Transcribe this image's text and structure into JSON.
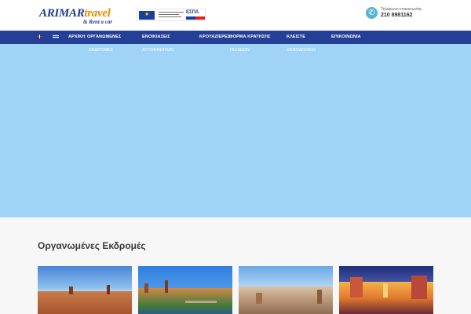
{
  "header": {
    "logo": {
      "main_a": "ARIMAR",
      "main_b": "travel",
      "sub": "& Rent a car"
    },
    "eu_badge": {
      "espa_label": "ΕΣΠΑ"
    },
    "contact": {
      "label": "Τηλέφωνο επικοινωνίας",
      "phone": "210 8981162",
      "icon": "phone-icon"
    }
  },
  "nav": {
    "languages": [
      "en",
      "el"
    ],
    "items": [
      {
        "line1": "ΑΡΧΙΚΗ",
        "line2": ""
      },
      {
        "line1": "ΟΡΓΑΝΩΜΕΝΕΣ",
        "line2": "ΕΚΔΡΟΜΕΣ"
      },
      {
        "line1": "ΕΝΟΙΚΙΑΣΕΙΣ",
        "line2": "ΑΥΤΟΚΙΝΗΤΩΝ"
      },
      {
        "line1": "ΚΡΟΥΑΖΙΕΡΕΣ",
        "line2": ""
      },
      {
        "line1": "ΦΟΡΜΑ ΚΡΑΤΗΣΗΣ",
        "line2": "ΤΑΞΙΔΙΩΝ"
      },
      {
        "line1": "ΚΛΕΙΣΤΕ",
        "line2": "ΞΕΝΟΔΟΧΕΙΟ"
      },
      {
        "line1": "ΕΠΙΚΟΙΝΩΝΙΑ",
        "line2": ""
      }
    ]
  },
  "colors": {
    "nav_bg": "#233f96",
    "hero_bg": "#a0d4f7",
    "accent_orange": "#f08a00",
    "brand_blue": "#1f3a8a"
  },
  "section": {
    "title": "Οργανωμένες Εκδρομές"
  }
}
